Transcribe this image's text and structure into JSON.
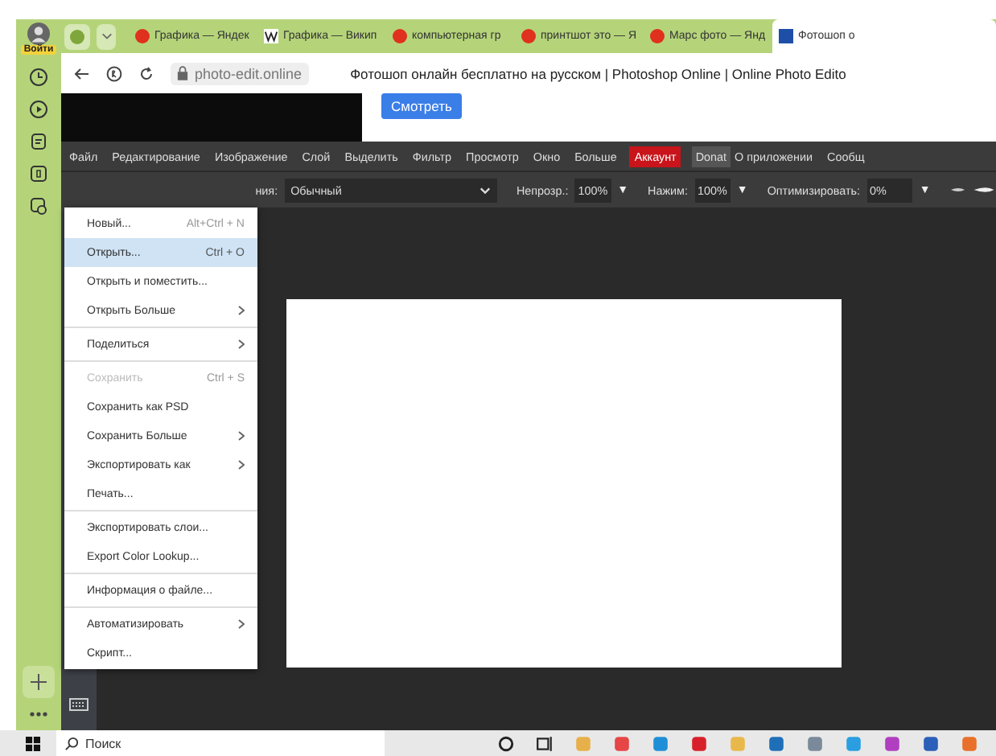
{
  "browser_sidebar": {
    "login_badge": "Войти"
  },
  "tabs": [
    {
      "kind": "yandex",
      "title": "Графика — Яндек",
      "selected": false
    },
    {
      "kind": "wiki",
      "title": "Графика — Викип",
      "selected": false
    },
    {
      "kind": "yandex",
      "title": "компьютерная гр",
      "selected": false
    },
    {
      "kind": "yandex",
      "title": "принтшот это — Я",
      "selected": false
    },
    {
      "kind": "yandex",
      "title": "Марс фото — Янд",
      "selected": false
    },
    {
      "kind": "ps",
      "title": "Фотошоп о",
      "selected": true
    }
  ],
  "address_bar": {
    "url": "photo-edit.online",
    "page_title": "Фотошоп онлайн бесплатно на русском | Photoshop Online | Online Photo Edito"
  },
  "ad": {
    "button": "Смотреть"
  },
  "menu_bar": [
    {
      "label": "Файл",
      "kind": "plain"
    },
    {
      "label": "Редактирование",
      "kind": "plain"
    },
    {
      "label": "Изображение",
      "kind": "plain"
    },
    {
      "label": "Слой",
      "kind": "plain"
    },
    {
      "label": "Выделить",
      "kind": "plain"
    },
    {
      "label": "Фильтр",
      "kind": "plain"
    },
    {
      "label": "Просмотр",
      "kind": "plain"
    },
    {
      "label": "Окно",
      "kind": "plain"
    },
    {
      "label": "Больше",
      "kind": "plain"
    },
    {
      "label": "Аккаунт",
      "kind": "account"
    },
    {
      "label": "Donat",
      "kind": "donate"
    },
    {
      "label": "О приложении",
      "kind": "plain"
    },
    {
      "label": "Сообщ",
      "kind": "plain"
    }
  ],
  "options_bar": {
    "blend_label": "ния:",
    "blend_mode": "Обычный",
    "opacity_label": "Непрозр.:",
    "opacity": "100%",
    "opacity_arrow": "▼",
    "pressure_label": "Нажим:",
    "pressure": "100%",
    "pressure_arrow": "▼",
    "optimize_label": "Оптимизировать:",
    "optimize": "0%",
    "optimize_arrow": "▼"
  },
  "file_menu": [
    [
      {
        "label": "Новый...",
        "shortcut": "Alt+Ctrl + N",
        "submenu": false,
        "disabled": false,
        "selected": false
      },
      {
        "label": "Открыть...",
        "shortcut": "Ctrl + O",
        "submenu": false,
        "disabled": false,
        "selected": true
      },
      {
        "label": "Открыть и поместить...",
        "submenu": false,
        "disabled": false,
        "selected": false
      },
      {
        "label": "Открыть Больше",
        "submenu": true,
        "disabled": false,
        "selected": false
      }
    ],
    [
      {
        "label": "Поделиться",
        "submenu": true,
        "disabled": false,
        "selected": false
      }
    ],
    [
      {
        "label": "Сохранить",
        "shortcut": "Ctrl + S",
        "submenu": false,
        "disabled": true,
        "selected": false
      },
      {
        "label": "Сохранить как PSD",
        "submenu": false,
        "disabled": false,
        "selected": false
      },
      {
        "label": "Сохранить Больше",
        "submenu": true,
        "disabled": false,
        "selected": false
      },
      {
        "label": "Экспортировать как",
        "submenu": true,
        "disabled": false,
        "selected": false
      },
      {
        "label": "Печать...",
        "submenu": false,
        "disabled": false,
        "selected": false
      }
    ],
    [
      {
        "label": "Экспортировать слои...",
        "submenu": false,
        "disabled": false,
        "selected": false
      },
      {
        "label": "Export Color Lookup...",
        "submenu": false,
        "disabled": false,
        "selected": false
      }
    ],
    [
      {
        "label": "Информация о файле...",
        "submenu": false,
        "disabled": false,
        "selected": false
      }
    ],
    [
      {
        "label": "Автоматизировать",
        "submenu": true,
        "disabled": false,
        "selected": false
      },
      {
        "label": "Скрипт...",
        "submenu": false,
        "disabled": false,
        "selected": false
      }
    ]
  ],
  "taskbar": {
    "search_placeholder": "Поиск"
  }
}
